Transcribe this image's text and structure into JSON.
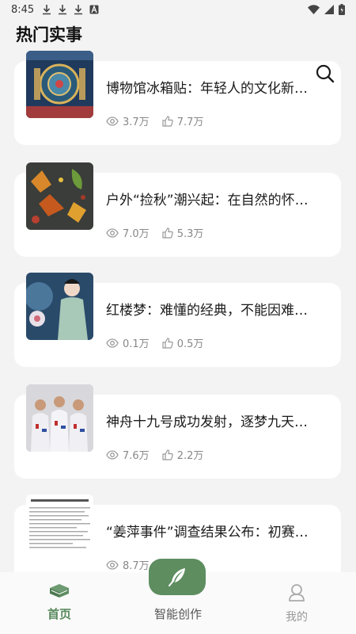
{
  "status_bar": {
    "time": "8:45"
  },
  "header": {
    "title": "热门实事"
  },
  "articles": [
    {
      "title": "博物馆冰箱贴：年轻人的文化新…",
      "views": "3.7万",
      "likes": "7.7万",
      "thumb_icon": "museum-magnet-image"
    },
    {
      "title": "户外“捡秋”潮兴起：在自然的怀…",
      "views": "7.0万",
      "likes": "5.3万",
      "thumb_icon": "autumn-leaves-image"
    },
    {
      "title": "红楼梦：难懂的经典，不能因难…",
      "views": "0.1万",
      "likes": "0.5万",
      "thumb_icon": "red-mansion-woman-image"
    },
    {
      "title": "神舟十九号成功发射，逐梦九天…",
      "views": "7.6万",
      "likes": "2.2万",
      "thumb_icon": "astronauts-image"
    },
    {
      "title": "“姜萍事件”调查结果公布：初赛…",
      "views": "8.7万",
      "likes": "",
      "thumb_icon": "document-image"
    }
  ],
  "bottom_nav": {
    "home": "首页",
    "create": "智能创作",
    "mine": "我的"
  },
  "colors": {
    "accent": "#5e8d60",
    "active_label": "#5a8a5e",
    "background": "#f3f3f3"
  }
}
